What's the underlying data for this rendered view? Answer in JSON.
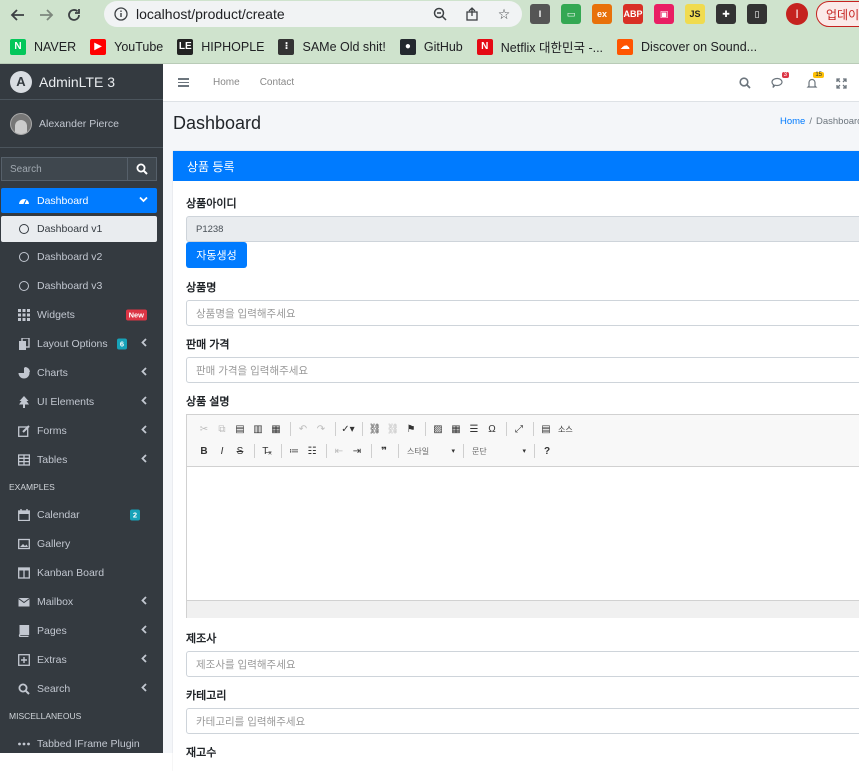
{
  "browser": {
    "url": "localhost/product/create",
    "profile_initial": "I",
    "update_label": "업데이",
    "bookmarks": [
      {
        "label": "NAVER",
        "icon": "N",
        "color": "#03c75a"
      },
      {
        "label": "YouTube",
        "icon": "▶",
        "color": "#ff0000"
      },
      {
        "label": "HIPHOPLE",
        "icon": "LE",
        "color": "#222222"
      },
      {
        "label": "SAMe Old shit!",
        "icon": "⁝",
        "color": "#333333"
      },
      {
        "label": "GitHub",
        "icon": "●",
        "color": "#24292f"
      },
      {
        "label": "Netflix 대한민국 -...",
        "icon": "N",
        "color": "#e50914"
      },
      {
        "label": "Discover on Sound...",
        "icon": "☁",
        "color": "#ff5500"
      }
    ],
    "extensions": [
      {
        "label": "I",
        "color": "#555555"
      },
      {
        "label": "▭",
        "color": "#34a853"
      },
      {
        "label": "ex",
        "color": "#e8710a"
      },
      {
        "label": "ABP",
        "color": "#d93025"
      },
      {
        "label": "▣",
        "color": "#e91e63"
      },
      {
        "label": "JS",
        "color": "#f0db4f"
      },
      {
        "label": "✚",
        "color": "#333333"
      },
      {
        "label": "▯",
        "color": "#333333"
      }
    ]
  },
  "sidebar": {
    "brand": "AdminLTE 3",
    "user": "Alexander Pierce",
    "search_placeholder": "Search",
    "items": [
      {
        "label": "Dashboard",
        "icon": "dashboard-icon",
        "active": true
      },
      {
        "label": "Dashboard v1",
        "icon": "circle-icon",
        "sub_active": true
      },
      {
        "label": "Dashboard v2",
        "icon": "circle-icon"
      },
      {
        "label": "Dashboard v3",
        "icon": "circle-icon"
      },
      {
        "label": "Widgets",
        "icon": "widgets-icon",
        "badge": "New"
      },
      {
        "label": "Layout Options",
        "icon": "copy-icon",
        "badge": "6"
      },
      {
        "label": "Charts",
        "icon": "pie-chart-icon"
      },
      {
        "label": "UI Elements",
        "icon": "tree-icon"
      },
      {
        "label": "Forms",
        "icon": "edit-icon"
      },
      {
        "label": "Tables",
        "icon": "table-icon"
      }
    ],
    "examples_header": "EXAMPLES",
    "example_items": [
      {
        "label": "Calendar",
        "icon": "calendar-icon",
        "badge": "2"
      },
      {
        "label": "Gallery",
        "icon": "image-icon"
      },
      {
        "label": "Kanban Board",
        "icon": "columns-icon"
      },
      {
        "label": "Mailbox",
        "icon": "envelope-icon"
      },
      {
        "label": "Pages",
        "icon": "book-icon"
      },
      {
        "label": "Extras",
        "icon": "plus-square-icon"
      },
      {
        "label": "Search",
        "icon": "search-icon"
      }
    ],
    "misc_header": "MISCELLANEOUS",
    "misc_items": [
      {
        "label": "Tabbed IFrame Plugin",
        "icon": "ellipsis-icon"
      }
    ]
  },
  "topnav": {
    "home": "Home",
    "contact": "Contact",
    "messages_count": "3",
    "notifications_count": "15"
  },
  "page": {
    "title": "Dashboard",
    "breadcrumb_home": "Home",
    "breadcrumb_sep": "/",
    "breadcrumb_current": "Dashboard"
  },
  "form": {
    "card_title": "상품 등록",
    "product_id_label": "상품아이디",
    "product_id_value": "P1238",
    "auto_generate_button": "자동생성",
    "name_label": "상품명",
    "name_placeholder": "상품명을 입력해주세요",
    "price_label": "판매 가격",
    "price_placeholder": "판매 가격을 입력해주세요",
    "description_label": "상품 설명",
    "maker_label": "제조사",
    "maker_placeholder": "제조사를 입력해주세요",
    "category_label": "카테고리",
    "category_placeholder": "카테고리를 입력해주세요",
    "stock_label": "재고수"
  },
  "editor": {
    "source_label": "소스",
    "style_combo": "스타일",
    "format_combo": "문단"
  }
}
